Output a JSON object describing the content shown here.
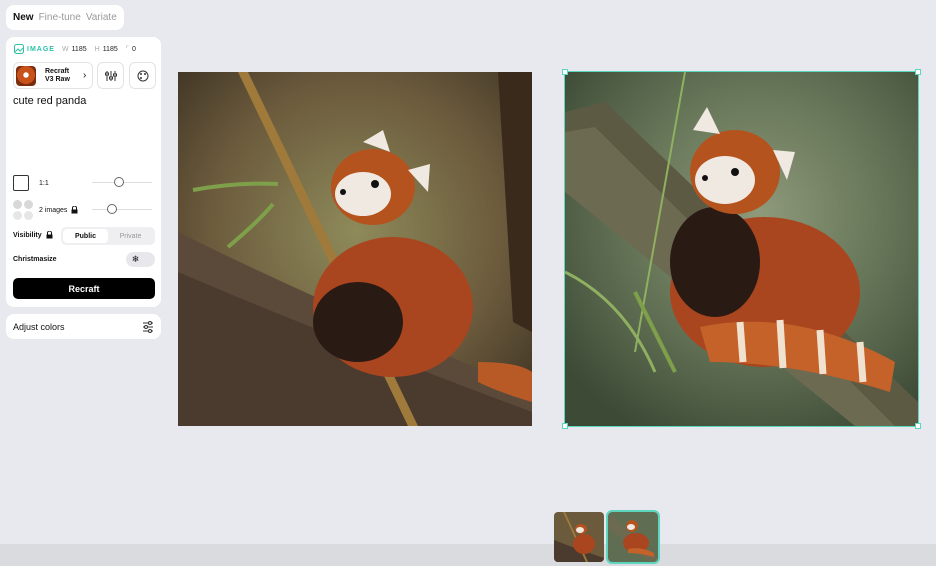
{
  "mode_tabs": [
    "New",
    "Fine-tune",
    "Variate"
  ],
  "image_meta": {
    "label": "IMAGE",
    "w_label": "W",
    "w_value": "1185",
    "h_label": "H",
    "h_value": "1185",
    "r_value": "0"
  },
  "model": {
    "name_line1": "Recraft",
    "name_line2": "V3 Raw"
  },
  "prompt": "cute red panda",
  "aspect": {
    "value": "1:1"
  },
  "images_count": {
    "value": "2 images"
  },
  "visibility": {
    "label": "Visibility",
    "options": [
      "Public",
      "Private"
    ],
    "selected": "Public"
  },
  "christmasize": {
    "label": "Christmasize",
    "enabled": false
  },
  "recraft_button": "Recraft",
  "adjust_colors": "Adjust colors",
  "colors": {
    "accent": "#2cc2a7",
    "selection": "#5dd6c0"
  }
}
